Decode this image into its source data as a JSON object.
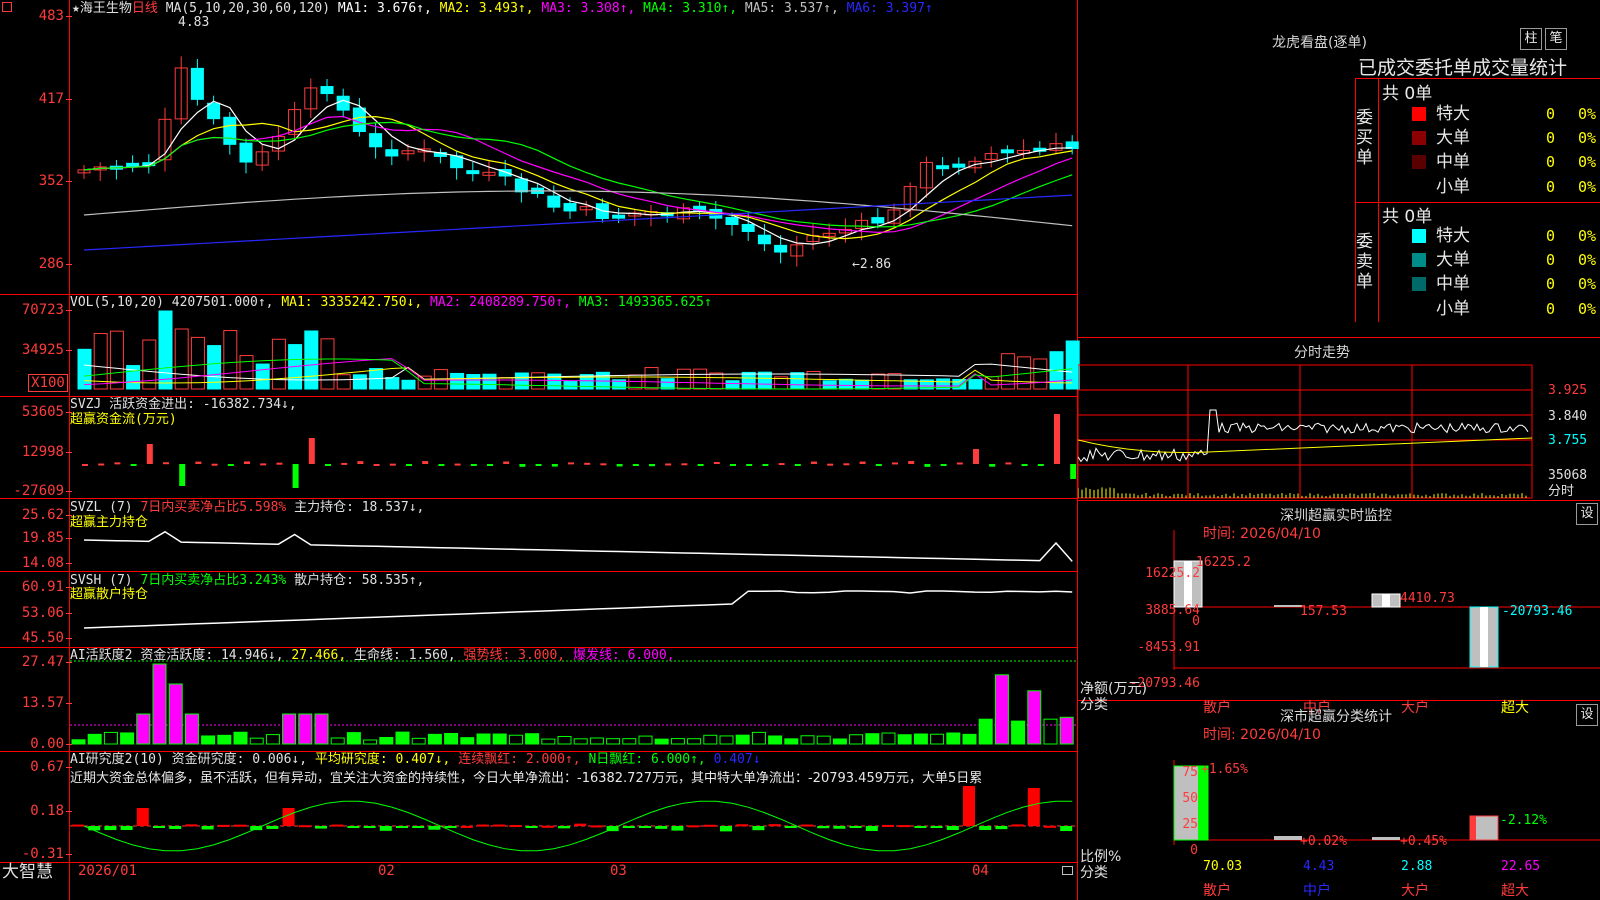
{
  "stock": {
    "star": "★",
    "name": "海王生物",
    "period": "日线"
  },
  "colors": {
    "up": "#ff3c3c",
    "down": "#00ffff",
    "grid": "#ff0000",
    "ma1": "#ffffff",
    "ma2": "#ffff00",
    "ma3": "#ff00ff",
    "ma4": "#00ff00",
    "ma5": "#c0c0c0",
    "ma6": "#2828ff"
  },
  "main_header": {
    "ma_label": "MA(5,10,20,30,60,120)",
    "items": [
      {
        "text": "MA1: 3.676↑,",
        "color": "#ffffff"
      },
      {
        "text": "MA2: 3.493↑,",
        "color": "#ffff00"
      },
      {
        "text": "MA3: 3.308↑,",
        "color": "#ff00ff"
      },
      {
        "text": "MA4: 3.310↑,",
        "color": "#00ff00"
      },
      {
        "text": "MA5: 3.537↑,",
        "color": "#c0c0c0"
      },
      {
        "text": "MA6: 3.397↑",
        "color": "#2828ff"
      }
    ],
    "high_mark": "4.83",
    "low_mark": "←2.86"
  },
  "main_axis": [
    "483",
    "417",
    "352",
    "286"
  ],
  "vol_header": {
    "label": "VOL(5,10,20)",
    "v": "4207501.000↑,",
    "ma1": "MA1: 3335242.750↓,",
    "ma2": "MA2: 2408289.750↑,",
    "ma3": "MA3: 1493365.625↑"
  },
  "vol_axis": [
    "70723",
    "34925",
    "X100"
  ],
  "svzj": {
    "label": "SVZJ",
    "text": "活跃资金进出: -16382.734↓,",
    "sub": "超赢资金流(万元)",
    "axis": [
      "53605",
      "12998",
      "-27609"
    ]
  },
  "svzl": {
    "label": "SVZL (7)",
    "text1": "7日内买卖净占比5.598%",
    "text2": "主力持仓: 18.537↓,",
    "sub": "超赢主力持仓",
    "axis": [
      "25.62",
      "19.85",
      "14.08"
    ]
  },
  "svsh": {
    "label": "SVSH (7)",
    "text1": "7日内买卖净占比3.243%",
    "text2": "散户持仓: 58.535↑,",
    "sub": "超赢散户持仓",
    "axis": [
      "60.91",
      "53.06",
      "45.50"
    ]
  },
  "ai1": {
    "label": "AI活跃度2",
    "t1": "资金活跃度: 14.946↓,",
    "t2": "27.466,",
    "t3": "生命线: 1.560,",
    "t4": "强势线: 3.000,",
    "t5": "爆发线: 6.000,",
    "axis": [
      "27.47",
      "13.57",
      "0.00"
    ]
  },
  "ai2": {
    "label": "AI研究度2(10)",
    "t1": "资金研究度: 0.006↓,",
    "t2": "平均研究度: 0.407↓,",
    "t3": "连续飘红: 2.000↑,",
    "t4": "N日飘红: 6.000↑,",
    "t5": "0.407↓",
    "msg": "近期大资金总体偏多，虽不活跃，但有异动，宜关注大资金的持续性，今日大单净流出：-16382.727万元，其中特大单净流出：-20793.459万元，大单5日累",
    "axis": [
      "0.67",
      "0.18",
      "-0.31"
    ]
  },
  "xaxis": {
    "brand": "大智慧",
    "labels": [
      "2026/01",
      "02",
      "03",
      "04"
    ]
  },
  "lhb": {
    "title": "龙虎看盘(逐单)",
    "btn1": "柱",
    "btn2": "笔",
    "subtitle": "已成交委托单成交量统计"
  },
  "buy": {
    "label": "委买单",
    "count": "共 0单",
    "rows": [
      {
        "name": "特大",
        "c1": "0",
        "c2": "0%",
        "color": "#ff0000"
      },
      {
        "name": "大单",
        "c1": "0",
        "c2": "0%",
        "color": "#8b0000"
      },
      {
        "name": "中单",
        "c1": "0",
        "c2": "0%",
        "color": "#5a0000"
      },
      {
        "name": "小单",
        "c1": "0",
        "c2": "0%",
        "color": ""
      }
    ]
  },
  "sell": {
    "label": "委卖单",
    "count": "共 0单",
    "rows": [
      {
        "name": "特大",
        "c1": "0",
        "c2": "0%",
        "color": "#00ffff"
      },
      {
        "name": "大单",
        "c1": "0",
        "c2": "0%",
        "color": "#008b8b"
      },
      {
        "name": "中单",
        "c1": "0",
        "c2": "0%",
        "color": "#006a6a"
      },
      {
        "name": "小单",
        "c1": "0",
        "c2": "0%",
        "color": ""
      }
    ]
  },
  "intraday": {
    "title": "分时走势",
    "axis": [
      "3.925",
      "3.840",
      "3.755",
      "35068",
      "分时"
    ]
  },
  "sz_monitor": {
    "title": "深圳超赢实时监控",
    "btn": "设",
    "date": "时间: 2026/04/10",
    "axis": [
      "16225.2",
      "3885.64",
      "0",
      "-8453.91",
      "-20793.46"
    ],
    "unit1": "净额(万元)",
    "unit2": "分类",
    "values": [
      "16225.2",
      "157.53",
      "4410.73",
      "-20793.46"
    ],
    "cats": [
      "散户",
      "中户",
      "大户",
      "超大"
    ]
  },
  "sz_class": {
    "title": "深市超赢分类统计",
    "btn": "设",
    "date": "时间: 2026/04/10",
    "axis": [
      "75",
      "50",
      "25",
      "0"
    ],
    "unit1": "比例%",
    "unit2": "分类",
    "top": [
      "+1.65%",
      "+0.02%",
      "+0.45%",
      "-2.12%"
    ],
    "bottom": [
      "70.03",
      "4.43",
      "2.88",
      "22.65"
    ],
    "cats": [
      "散户",
      "中户",
      "大户",
      "超大"
    ]
  }
}
